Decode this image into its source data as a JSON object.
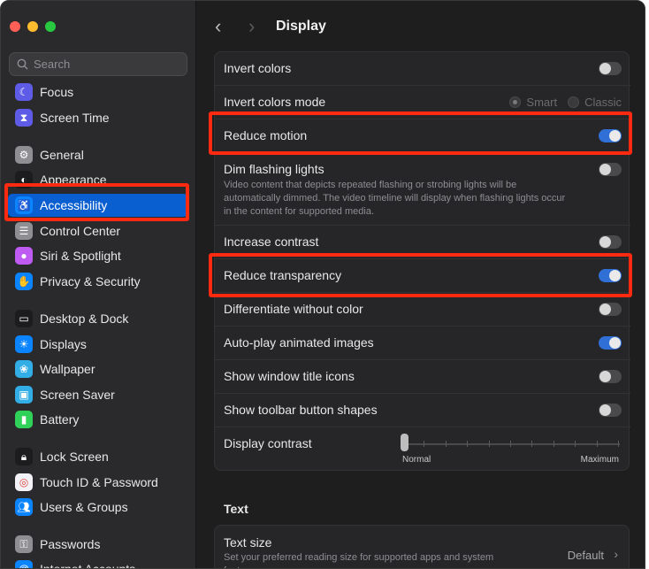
{
  "window": {
    "title": "Display"
  },
  "sidebar": {
    "search_placeholder": "Search",
    "items": [
      {
        "label": "Focus",
        "icon": "moon-icon",
        "color": "#5e5ce6"
      },
      {
        "label": "Screen Time",
        "icon": "hourglass-icon",
        "color": "#5e5ce6"
      },
      {
        "label": "General",
        "icon": "gear-icon",
        "color": "#8e8e93"
      },
      {
        "label": "Appearance",
        "icon": "appearance-icon",
        "color": "#1c1c1e"
      },
      {
        "label": "Accessibility",
        "icon": "accessibility-icon",
        "color": "#0a84ff"
      },
      {
        "label": "Control Center",
        "icon": "control-center-icon",
        "color": "#8e8e93"
      },
      {
        "label": "Siri & Spotlight",
        "icon": "siri-icon",
        "color": "#bf5af2"
      },
      {
        "label": "Privacy & Security",
        "icon": "hand-icon",
        "color": "#0a84ff"
      },
      {
        "label": "Desktop & Dock",
        "icon": "dock-icon",
        "color": "#1c1c1e"
      },
      {
        "label": "Displays",
        "icon": "sun-icon",
        "color": "#0a84ff"
      },
      {
        "label": "Wallpaper",
        "icon": "wallpaper-icon",
        "color": "#32ade6"
      },
      {
        "label": "Screen Saver",
        "icon": "screen-saver-icon",
        "color": "#32ade6"
      },
      {
        "label": "Battery",
        "icon": "battery-icon",
        "color": "#30d158"
      },
      {
        "label": "Lock Screen",
        "icon": "lock-icon",
        "color": "#1c1c1e"
      },
      {
        "label": "Touch ID & Password",
        "icon": "fingerprint-icon",
        "color": "#f2f2f7"
      },
      {
        "label": "Users & Groups",
        "icon": "users-icon",
        "color": "#0a84ff"
      },
      {
        "label": "Passwords",
        "icon": "key-icon",
        "color": "#8e8e93"
      },
      {
        "label": "Internet Accounts",
        "icon": "at-icon",
        "color": "#0a84ff"
      }
    ]
  },
  "display": {
    "invert_colors": {
      "label": "Invert colors",
      "on": false
    },
    "invert_colors_mode": {
      "label": "Invert colors mode",
      "options": [
        "Smart",
        "Classic"
      ],
      "selected": "Smart"
    },
    "reduce_motion": {
      "label": "Reduce motion",
      "on": true
    },
    "dim_flashing": {
      "label": "Dim flashing lights",
      "description": "Video content that depicts repeated flashing or strobing lights will be automatically dimmed. The video timeline will display when flashing lights occur in the content for supported media.",
      "on": false
    },
    "increase_contrast": {
      "label": "Increase contrast",
      "on": false
    },
    "reduce_transparency": {
      "label": "Reduce transparency",
      "on": true
    },
    "differentiate": {
      "label": "Differentiate without color",
      "on": false
    },
    "autoplay": {
      "label": "Auto-play animated images",
      "on": true
    },
    "title_icons": {
      "label": "Show window title icons",
      "on": false
    },
    "toolbar_shapes": {
      "label": "Show toolbar button shapes",
      "on": false
    },
    "display_contrast": {
      "label": "Display contrast",
      "min_label": "Normal",
      "max_label": "Maximum",
      "value": 0
    }
  },
  "text_section": {
    "title": "Text",
    "text_size": {
      "label": "Text size",
      "description": "Set your preferred reading size for supported apps and system features.",
      "value": "Default"
    }
  },
  "colors": {
    "accent": "#2f6fd6",
    "highlight": "#ff2a10",
    "sidebar_active": "#0a5fd0"
  }
}
